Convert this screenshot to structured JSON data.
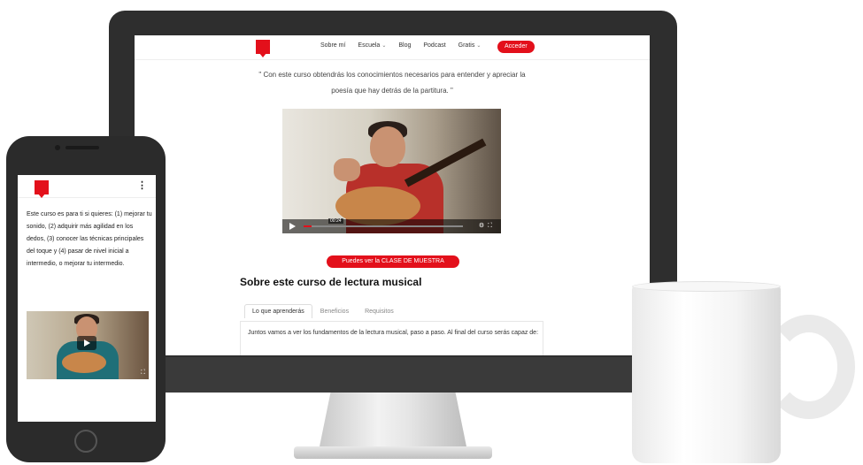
{
  "desktop": {
    "nav": {
      "items": [
        {
          "label": "Sobre mí",
          "has_dropdown": false
        },
        {
          "label": "Escuela",
          "has_dropdown": true
        },
        {
          "label": "Blog",
          "has_dropdown": false
        },
        {
          "label": "Podcast",
          "has_dropdown": false
        },
        {
          "label": "Gratis",
          "has_dropdown": true
        }
      ],
      "cta": "Acceder"
    },
    "quote_line1": "\" Con este curso obtendrás los conocimientos necesarios para entender y apreciar la",
    "quote_line2": "poesía que hay detrás de la partitura. \"",
    "video": {
      "time": "00:24",
      "progress": 0.05
    },
    "sample_button": "Puedes ver la CLASE DE MUESTRA",
    "section_title": "Sobre este curso de lectura musical",
    "tabs": [
      {
        "label": "Lo que aprenderás",
        "active": true
      },
      {
        "label": "Beneficios",
        "active": false
      },
      {
        "label": "Requisitos",
        "active": false
      }
    ],
    "tab_text": "Juntos vamos a ver los fundamentos de la lectura musical, paso a paso. Al final del curso serás capaz de:"
  },
  "mobile": {
    "text": "Este curso es para ti si quieres: (1) mejorar tu sonido, (2) adquirir más agilidad en los dedos, (3) conocer las técnicas principales del toque y (4) pasar de nivel inicial a intermedio, o mejorar tu intermedio."
  },
  "colors": {
    "accent": "#e3101b",
    "device": "#2e2e2e"
  },
  "icons": [
    "logo-bookmark-icon",
    "chevron-down-icon",
    "play-icon",
    "settings-icon",
    "fullscreen-icon",
    "kebab-menu-icon"
  ]
}
